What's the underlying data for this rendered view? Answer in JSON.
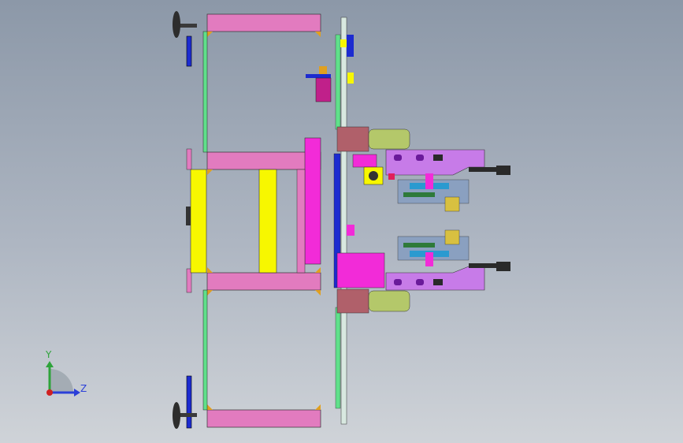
{
  "viewport": {
    "background_top": "#8c98a8",
    "background_bottom": "#cfd3d8"
  },
  "triad": {
    "y_label": "Y",
    "z_label": "Z",
    "y_color": "#2ea33a",
    "z_color": "#2b3fd8",
    "origin_color": "#d02020"
  },
  "palette": {
    "frame_pink": "#e27bbf",
    "magenta": "#f22bd8",
    "yellow": "#f7f700",
    "green_rail": "#5fe08a",
    "gold_gusset": "#e0a020",
    "handwheel": "#3a3a3a",
    "blue_bar": "#1c2bd0",
    "violet_arm": "#c77be8",
    "olive_drum": "#b4c86a",
    "brown_block": "#b0606a"
  }
}
